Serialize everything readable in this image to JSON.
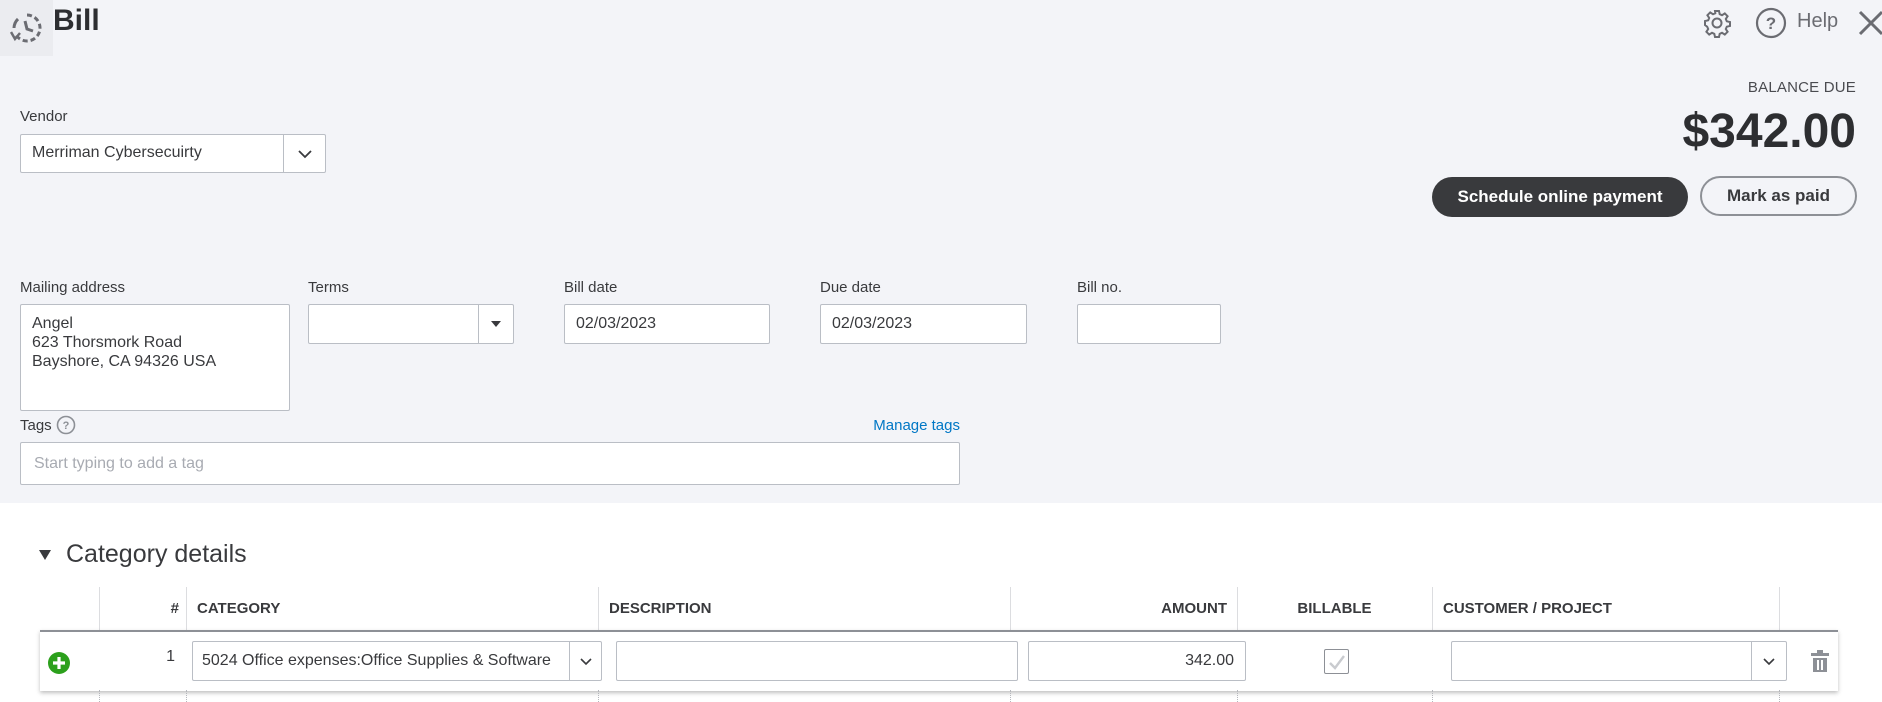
{
  "header": {
    "title": "Bill",
    "help_label": "Help",
    "icons": [
      "history-icon",
      "gear-icon",
      "help-circle-icon",
      "close-icon"
    ]
  },
  "balance": {
    "label": "BALANCE DUE",
    "amount": "$342.00"
  },
  "actions": {
    "schedule_label": "Schedule online payment",
    "mark_paid_label": "Mark as paid"
  },
  "vendor": {
    "label": "Vendor",
    "value": "Merriman Cybersecuirty"
  },
  "mailing_address": {
    "label": "Mailing address",
    "value": "Angel\n623 Thorsmork Road\nBayshore, CA  94326 USA"
  },
  "terms": {
    "label": "Terms",
    "value": ""
  },
  "bill_date": {
    "label": "Bill date",
    "value": "02/03/2023"
  },
  "due_date": {
    "label": "Due date",
    "value": "02/03/2023"
  },
  "bill_no": {
    "label": "Bill no.",
    "value": ""
  },
  "tags": {
    "label": "Tags",
    "manage_label": "Manage tags",
    "placeholder": "Start typing to add a tag"
  },
  "category_details": {
    "title": "Category details",
    "columns": [
      "#",
      "CATEGORY",
      "DESCRIPTION",
      "AMOUNT",
      "BILLABLE",
      "CUSTOMER / PROJECT"
    ],
    "rows": [
      {
        "num": "1",
        "category": "5024 Office expenses:Office Supplies & Software",
        "description": "",
        "amount": "342.00",
        "billable": true,
        "customer_project": ""
      }
    ]
  },
  "colors": {
    "accent_link": "#0077c5",
    "add_green": "#2ca01c",
    "dark_button": "#393a3d",
    "page_bg": "#f3f4f8"
  }
}
